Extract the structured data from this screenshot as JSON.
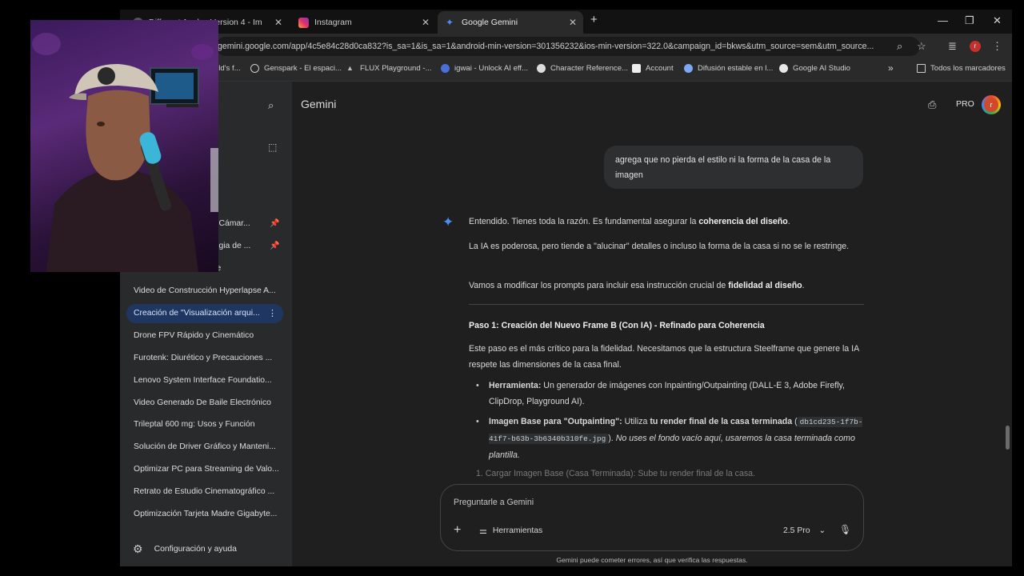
{
  "tabs": [
    {
      "label": "Different Angles Version 4 - Im",
      "active": false
    },
    {
      "label": "Instagram",
      "active": false
    },
    {
      "label": "Google Gemini",
      "active": true
    }
  ],
  "new_tab_symbol": "+",
  "url": "gemini.google.com/app/4c5e84c28d0ca832?is_sa=1&is_sa=1&android-min-version=301356232&ios-min-version=322.0&campaign_id=bkws&utm_source=sem&utm_source...",
  "bookmarks": [
    "rld's f...",
    "Genspark - El espaci...",
    "FLUX Playground -...",
    "igwai - Unlock AI eff...",
    "Character Reference...",
    "Account",
    "Difusión estable en l...",
    "Google AI Studio"
  ],
  "bookmarks_more": "»",
  "all_bookmarks": "Todos los marcadores",
  "sidebar": {
    "partial_items": [
      {
        "label": "de Cámar...",
        "pinned": true
      },
      {
        "label": "ategia de ...",
        "pinned": true
      },
      {
        "label": "age",
        "pinned": false
      }
    ],
    "items": [
      {
        "label": "Video de Construcción Hyperlapse A...",
        "active": false
      },
      {
        "label": "Creación de \"Visualización arqui...",
        "active": true
      },
      {
        "label": "Drone FPV Rápido y Cinemático",
        "active": false
      },
      {
        "label": "Furotenk: Diurético y Precauciones ...",
        "active": false
      },
      {
        "label": "Lenovo System Interface Foundatio...",
        "active": false
      },
      {
        "label": "Video Generado De Baile Electrónico",
        "active": false
      },
      {
        "label": "Trileptal 600 mg: Usos y Función",
        "active": false
      },
      {
        "label": "Solución de Driver Gráfico y Manteni...",
        "active": false
      },
      {
        "label": "Optimizar PC para Streaming de Valo...",
        "active": false
      },
      {
        "label": "Retrato de Estudio Cinematográfico ...",
        "active": false
      },
      {
        "label": "Optimización Tarjeta Madre Gigabyte...",
        "active": false
      }
    ],
    "settings_label": "Configuración y ayuda"
  },
  "header": {
    "title": "Gemini",
    "plan": "PRO",
    "avatar_initial": "r"
  },
  "user_message": "agrega que no pierda el estilo ni la forma de la casa de la imagen",
  "response": {
    "p1_a": "Entendido. Tienes toda la razón. Es fundamental asegurar la ",
    "p1_b": "coherencia del diseño",
    "p1_c": ".",
    "p2": "La IA es poderosa, pero tiende a \"alucinar\" detalles o incluso la forma de la casa si no se le restringe.",
    "p3_a": "Vamos a modificar los prompts para incluir esa instrucción crucial de ",
    "p3_b": "fidelidad al diseño",
    "p3_c": ".",
    "step_title": "Paso 1: Creación del Nuevo Frame B (Con IA) - Refinado para Coherencia",
    "step_desc": "Este paso es el más crítico para la fidelidad. Necesitamos que la estructura Steelframe que genere la IA respete las dimensiones de la casa final.",
    "bullet1_label": "Herramienta:",
    "bullet1_text": " Un generador de imágenes con Inpainting/Outpainting (DALL-E 3, Adobe Firefly, ClipDrop, Playground AI).",
    "bullet2_label": "Imagen Base para \"Outpainting\":",
    "bullet2_text_a": " Utiliza ",
    "bullet2_bold": "tu render final de la casa terminada",
    "bullet2_text_b": " (",
    "bullet2_code": "db1cd235-1f7b-41f7-b63b-3b6340b310fe.jpg",
    "bullet2_text_c": "). ",
    "bullet2_italic": "No uses el fondo vacío aquí, usaremos la casa terminada como plantilla.",
    "substep": "1.  Cargar Imagen Base (Casa Terminada): Sube tu render final de la casa."
  },
  "composer": {
    "placeholder": "Preguntarle a Gemini",
    "tools_label": "Herramientas",
    "model_label": "2.5 Pro"
  },
  "disclaimer": "Gemini puede cometer errores, así que verifica las respuestas."
}
